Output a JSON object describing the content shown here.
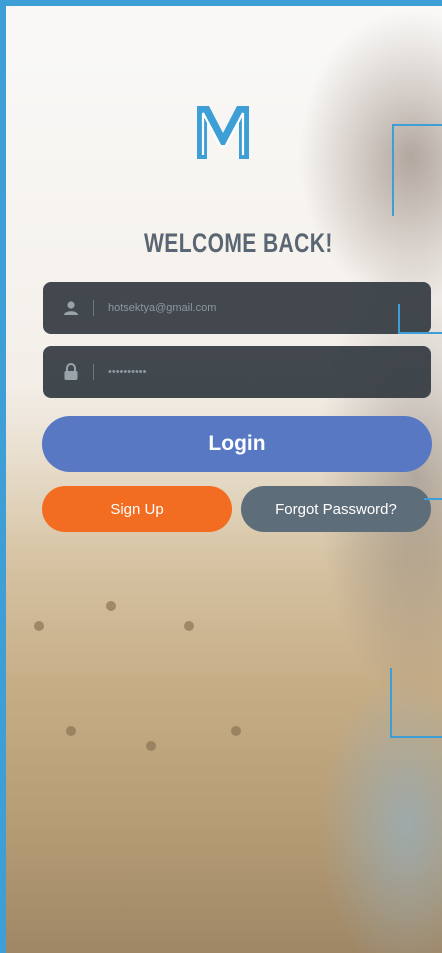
{
  "app": {
    "logo_letter": "M",
    "brand_color": "#3e9fd6"
  },
  "header": {
    "title": "WELCOME BACK!"
  },
  "form": {
    "email": {
      "value": "hotsektya@gmail.com",
      "icon": "user-icon"
    },
    "password": {
      "value": "••••••••••",
      "icon": "lock-icon"
    }
  },
  "buttons": {
    "login_label": "Login",
    "signup_label": "Sign Up",
    "forgot_label": "Forgot Password?"
  },
  "colors": {
    "login": "#5878c4",
    "signup": "#f26d21",
    "forgot": "#5e6d7a",
    "field": "#323a40"
  }
}
